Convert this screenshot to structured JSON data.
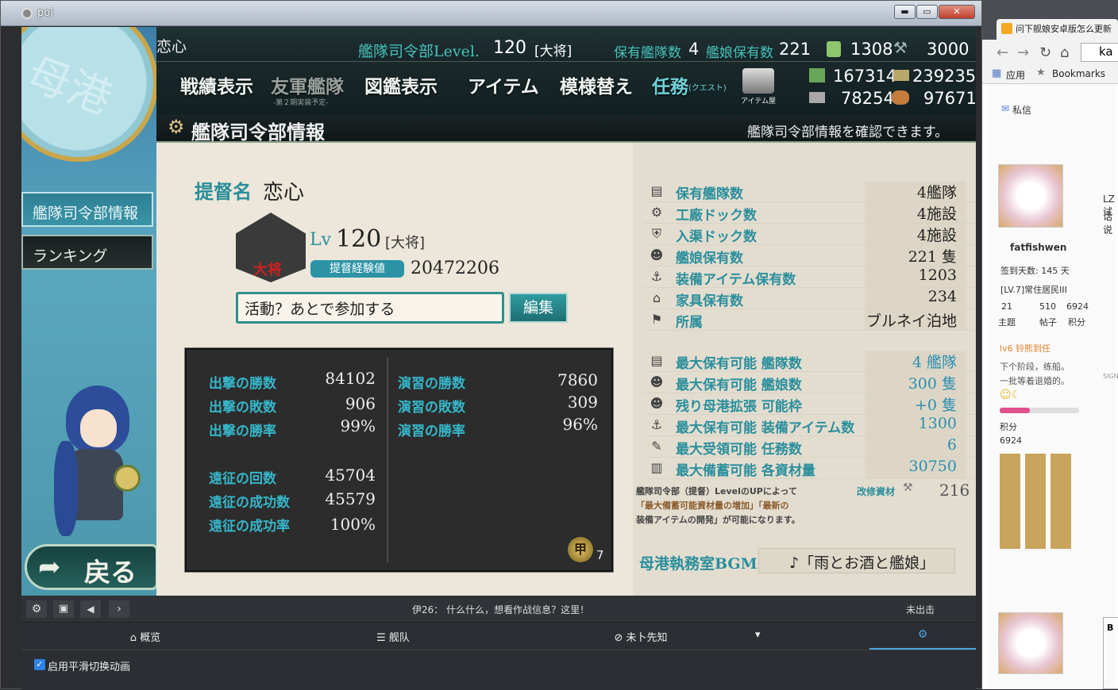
{
  "window": {
    "title": "poi",
    "min": "▬",
    "max": "▭",
    "close": "✕"
  },
  "top": {
    "admiral": "恋心",
    "level_label": "艦隊司令部Level.",
    "level": "120",
    "rank": "[大将]",
    "fleets_label": "保有艦隊数",
    "fleets": "4",
    "ships_label": "艦娘保有数",
    "ships": "221",
    "bucket": "1308",
    "devmat": "3000",
    "fuel": "167314",
    "ammo": "239235",
    "steel": "78254",
    "bauxite": "97671"
  },
  "nav": {
    "record": "戦績表示",
    "friend": "友軍艦隊",
    "friend_sub": "-第２期実装予定-",
    "album": "図鑑表示",
    "item": "アイテム",
    "remodel": "模様替え",
    "quest": "任務",
    "quest_sub": "(クエスト)",
    "shop_sub": "アイテム屋"
  },
  "infobar": {
    "title": "艦隊司令部情報",
    "desc": "艦隊司令部情報を確認できます。"
  },
  "sidebar": {
    "hq": "艦隊司令部情報",
    "ranking": "ランキング",
    "back": "戻る"
  },
  "profile": {
    "name_label": "提督名",
    "name": "恋心",
    "lv_label": "Lv",
    "lv": "120",
    "rank": "[大将]",
    "rank_badge": "大将",
    "exp_label": "提督経験値",
    "exp": "20472206",
    "comment": "活動？あとで参加する",
    "edit": "編集"
  },
  "stats": {
    "sortie_win_l": "出撃の勝数",
    "sortie_win": "84102",
    "sortie_lose_l": "出撃の敗数",
    "sortie_lose": "906",
    "sortie_rate_l": "出撃の勝率",
    "sortie_rate": "99%",
    "exer_win_l": "演習の勝数",
    "exer_win": "7860",
    "exer_lose_l": "演習の敗数",
    "exer_lose": "309",
    "exer_rate_l": "演習の勝率",
    "exer_rate": "96%",
    "exp_count_l": "遠征の回数",
    "exp_count": "45704",
    "exp_succ_l": "遠征の成功数",
    "exp_succ": "45579",
    "exp_rate_l": "遠征の成功率",
    "exp_rate": "100%",
    "medal_glyph": "甲",
    "medal_count": "7"
  },
  "right": [
    {
      "label": "保有艦隊数",
      "value": "4艦隊"
    },
    {
      "label": "工廠ドック数",
      "value": "4施設"
    },
    {
      "label": "入渠ドック数",
      "value": "4施設"
    },
    {
      "label": "艦娘保有数",
      "value": "221 隻"
    },
    {
      "label": "装備アイテム保有数",
      "value": "1203"
    },
    {
      "label": "家具保有数",
      "value": "234"
    },
    {
      "label": "所属",
      "value": "ブルネイ泊地"
    }
  ],
  "right2": [
    {
      "label": "最大保有可能 艦隊数",
      "value": "4 艦隊"
    },
    {
      "label": "最大保有可能 艦娘数",
      "value": "300 隻"
    },
    {
      "label": "残り母港拡張 可能枠",
      "value": "+0 隻"
    },
    {
      "label": "最大保有可能 装備アイテム数",
      "value": "1300"
    },
    {
      "label": "最大受領可能 任務数",
      "value": "6"
    },
    {
      "label": "最大備蓄可能 各資材量",
      "value": "30750"
    }
  ],
  "note": {
    "line1": "艦隊司令部（提督）LevelのUPによって",
    "line2": "「最大備蓄可能資材量の増加」「最新の",
    "line3": "装備アイテムの開発」が可能になります。",
    "kaishu_label": "改修資材",
    "kaishu": "216"
  },
  "bgm": {
    "label": "母港執務室BGM",
    "value": "♪「雨とお酒と艦娘」"
  },
  "poi": {
    "message": "伊26： 什么什么，想看作战信息？这里！",
    "status": "未出击",
    "tab_overview": "概览",
    "tab_fleet": "舰队",
    "tab_prophet": "未卜先知",
    "checkbox": "启用平滑切换动画"
  },
  "browser": {
    "tab": "问下舰娘安卓版怎么更新",
    "url": "ka",
    "apps": "应用",
    "bookmarks": "Bookmarks",
    "pm": "私信",
    "user": "fatfishwen",
    "signin": "签到天数: 145 天",
    "rank": "[LV.7]常住居民III",
    "topics": "21",
    "topics_l": "主题",
    "posts": "510",
    "posts_l": "帖子",
    "points": "6924",
    "points_l": "积分",
    "lv6": "lv6 铃熊到任",
    "text1": "下个阶段，练船。",
    "text2": "一批等着退婚的。",
    "pts_label": "积分",
    "pts": "6924",
    "lz": "LZ试",
    "lz2": "话说",
    "sig": "SIGN",
    "b": "B"
  }
}
